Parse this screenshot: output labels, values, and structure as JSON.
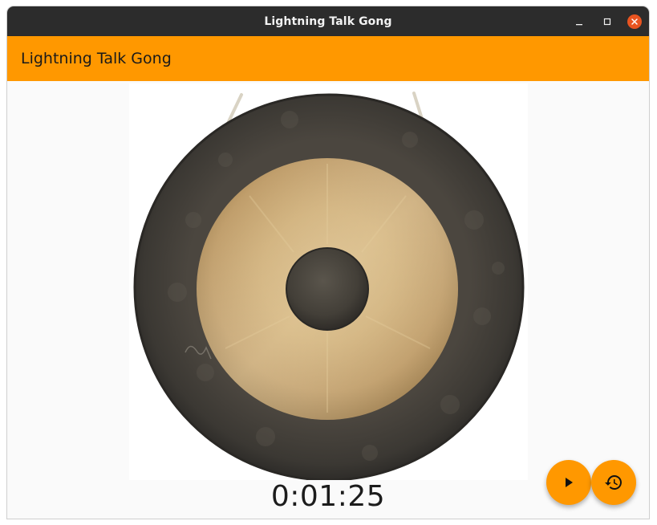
{
  "window": {
    "title": "Lightning Talk Gong"
  },
  "appbar": {
    "title": "Lightning Talk Gong",
    "color": "#ff9800"
  },
  "gong": {
    "icon": "gong-image"
  },
  "timer": {
    "value": "0:01:25"
  },
  "actions": {
    "play_icon": "play-icon",
    "reset_icon": "history-icon"
  },
  "colors": {
    "accent": "#ff9800",
    "titlebar": "#2c2c2c",
    "close": "#e95420"
  }
}
